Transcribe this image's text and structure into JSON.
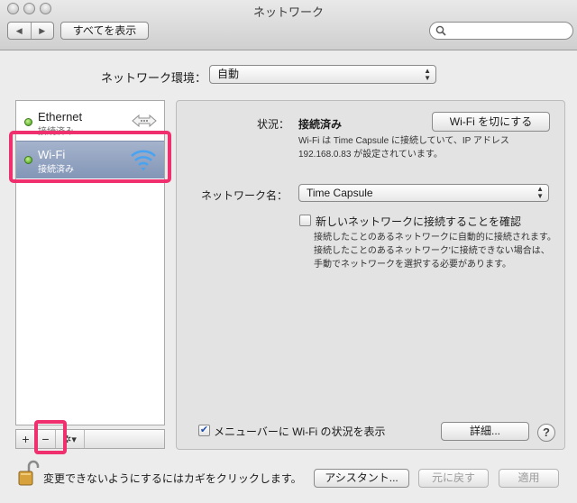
{
  "window": {
    "title": "ネットワーク"
  },
  "toolbar": {
    "back_glyph": "◀",
    "forward_glyph": "▶",
    "show_all_label": "すべてを表示",
    "search_placeholder": ""
  },
  "location": {
    "label": "ネットワーク環境：",
    "value": "自動"
  },
  "services": [
    {
      "name": "Ethernet",
      "status": "接続済み",
      "status_color": "#3f9b12",
      "icon": "ethernet-arrows-icon"
    },
    {
      "name": "Wi-Fi",
      "status": "接続済み",
      "status_color": "#3f9b12",
      "icon": "wifi-icon",
      "selected": true
    }
  ],
  "sidebar_bar": {
    "add": "+",
    "remove": "−",
    "action_glyph": "✲▾"
  },
  "detail": {
    "status_label": "状況：",
    "status_value": "接続済み",
    "toggle_wifi_label": "Wi-Fi を切にする",
    "status_description_line1": "Wi-Fi は Time Capsule に接続していて、IP アドレス",
    "status_description_line2": "192.168.0.83 が設定されています。",
    "network_name_label": "ネットワーク名：",
    "network_name_value": "Time Capsule",
    "ask_join_label": "新しいネットワークに接続することを確認",
    "ask_join_checked": false,
    "ask_join_help_line1": "接続したことのあるネットワークに自動的に接続されます。",
    "ask_join_help_line2": "接続したことのあるネットワーク'に接続できない場合は、",
    "ask_join_help_line3": "手動でネットワークを選択する必要があります。",
    "show_menu_label": "メニューバーに Wi-Fi の状況を表示",
    "show_menu_checked": true,
    "check_glyph": "✔",
    "advanced_label": "詳細...",
    "help_label": "?"
  },
  "footer": {
    "lock_text": "変更できないようにするにはカギをクリックします。",
    "assistant_label": "アシスタント...",
    "revert_label": "元に戻す",
    "apply_label": "適用"
  },
  "colors": {
    "highlight": "#f0306e",
    "selection": "#8396b7",
    "wifi_icon": "#3a8fe0"
  }
}
